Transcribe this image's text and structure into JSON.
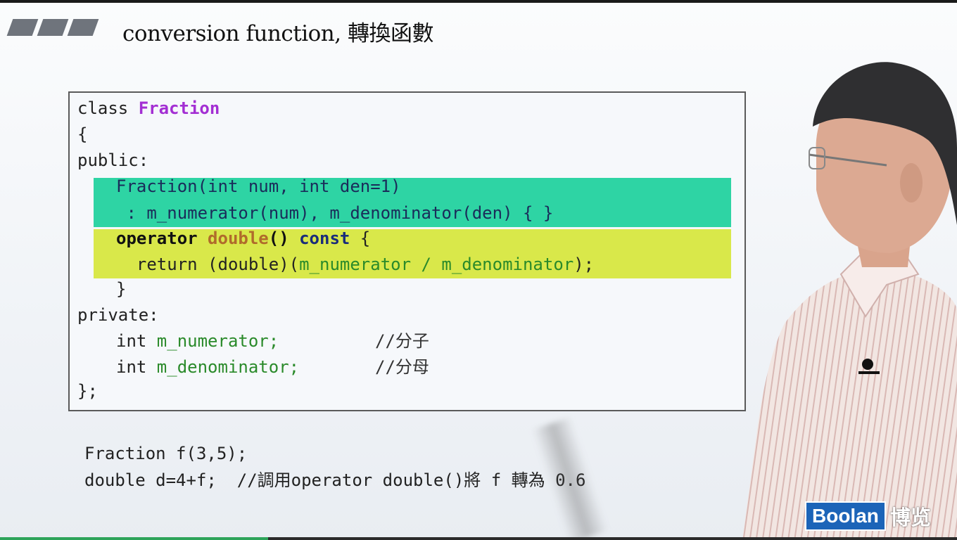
{
  "slide": {
    "title": "conversion function, 轉換函數"
  },
  "code": {
    "l1_kw": "class ",
    "l1_name": "Fraction",
    "l2": "{",
    "l3": "public:",
    "l4": "Fraction(int num, int den=1)",
    "l5": " : m_numerator(num), m_denominator(den) { }",
    "l6_op": "operator ",
    "l6_type": "double",
    "l6_paren": "() ",
    "l6_const": "const",
    "l6_brace": " {",
    "l7_ret": "  return (double)(",
    "l7_expr": "m_numerator / m_denominator",
    "l7_end": ");",
    "l8": "}",
    "l9": "private:",
    "l10_kw": "int ",
    "l10_var": "m_numerator;",
    "l10_cmt": "//分子",
    "l11_kw": "int ",
    "l11_var": "m_denominator;",
    "l11_cmt": "//分母",
    "l12": "};"
  },
  "example": {
    "line1": "Fraction f(3,5);",
    "line2": "double d=4+f;  //調用operator double()將 f 轉為 0.6"
  },
  "logo": {
    "brand": "Boolan",
    "brand_cn": "博览"
  },
  "player": {
    "progress": 0.28
  },
  "colors": {
    "highlight_green": "#2ed4a4",
    "highlight_yellow": "#d9e84a",
    "logo_blue": "#1c64b8"
  }
}
